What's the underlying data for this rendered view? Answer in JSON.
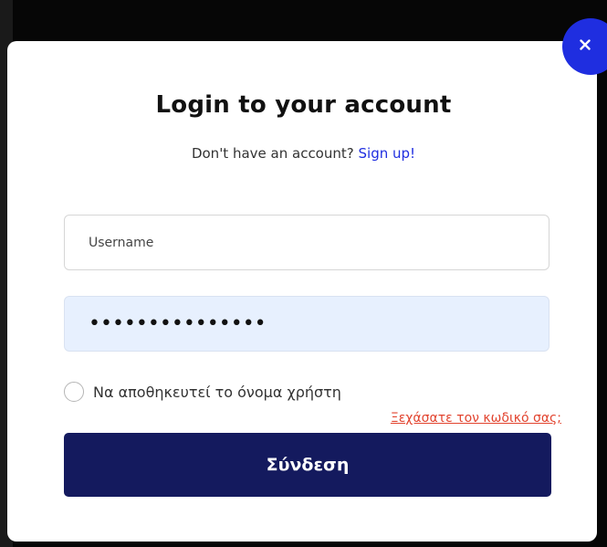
{
  "modal": {
    "title": "Login to your account",
    "signup_prompt": "Don't have an account?",
    "signup_link": "Sign up!",
    "username_placeholder": "Username",
    "password_value": "•••••••••••••••",
    "remember_label": "Να αποθηκευτεί το όνομα χρήστη",
    "forgot_link": "Ξεχάσατε τον κωδικό σας;",
    "submit_label": "Σύνδεση"
  },
  "colors": {
    "accent": "#1f2ee0",
    "submit_bg": "#141a5e",
    "password_bg": "#e7f0fe",
    "forgot_link": "#e2442f"
  },
  "icons": {
    "close": "close-icon"
  }
}
